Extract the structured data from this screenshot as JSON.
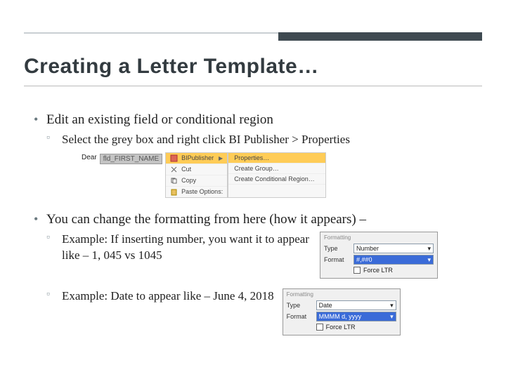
{
  "title": "Creating a Letter Template…",
  "b1": {
    "text": "Edit an existing field or conditional region",
    "sub1": "Select the grey box and right click BI Publisher > Properties"
  },
  "ctx": {
    "dear": "Dear",
    "field": "fld_FIRST_NAME",
    "col1": {
      "bi": "BIPublisher",
      "cut": "Cut",
      "copy": "Copy",
      "paste": "Paste Options:"
    },
    "col2": {
      "props": "Properties…",
      "group": "Create Group…",
      "cond": "Create Conditional Region…"
    }
  },
  "b2": {
    "text": "You can change the formatting from here (how it appears) –",
    "sub1": "Example: If inserting number, you want it to appear like – 1, 045 vs 1045",
    "sub2": "Example: Date to appear like – June 4, 2018"
  },
  "panel1": {
    "tab": "Formatting",
    "type_label": "Type",
    "type_value": "Number",
    "format_label": "Format",
    "format_value": "#,##0",
    "force": "Force LTR"
  },
  "panel2": {
    "tab": "Formatting",
    "type_label": "Type",
    "type_value": "Date",
    "format_label": "Format",
    "format_value": "MMMM d, yyyy",
    "force": "Force LTR"
  }
}
